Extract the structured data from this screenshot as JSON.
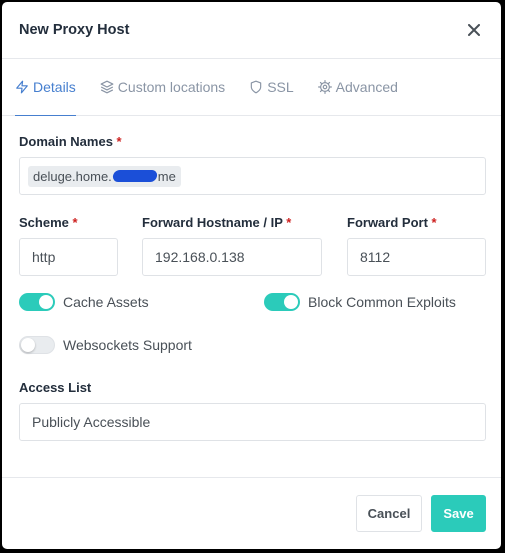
{
  "modal": {
    "title": "New Proxy Host"
  },
  "tabs": [
    {
      "label": "Details",
      "icon": "zap-icon",
      "active": true
    },
    {
      "label": "Custom locations",
      "icon": "layers-icon",
      "active": false
    },
    {
      "label": "SSL",
      "icon": "shield-icon",
      "active": false
    },
    {
      "label": "Advanced",
      "icon": "gear-icon",
      "active": false
    }
  ],
  "form": {
    "domain_names": {
      "label": "Domain Names",
      "required": "*",
      "chip_prefix": "deluge.home.",
      "chip_suffix": "me"
    },
    "scheme": {
      "label": "Scheme",
      "required": "*",
      "value": "http"
    },
    "forward_host": {
      "label": "Forward Hostname / IP",
      "required": "*",
      "value": "192.168.0.138"
    },
    "forward_port": {
      "label": "Forward Port",
      "required": "*",
      "value": "8112"
    },
    "cache_assets": {
      "label": "Cache Assets",
      "on": true
    },
    "block_exploits": {
      "label": "Block Common Exploits",
      "on": true
    },
    "websockets": {
      "label": "Websockets Support",
      "on": false
    },
    "access_list": {
      "label": "Access List",
      "value": "Publicly Accessible"
    }
  },
  "footer": {
    "cancel_label": "Cancel",
    "save_label": "Save"
  },
  "colors": {
    "accent": "#467fcf",
    "teal": "#2bcbba",
    "required": "#cd201f"
  }
}
